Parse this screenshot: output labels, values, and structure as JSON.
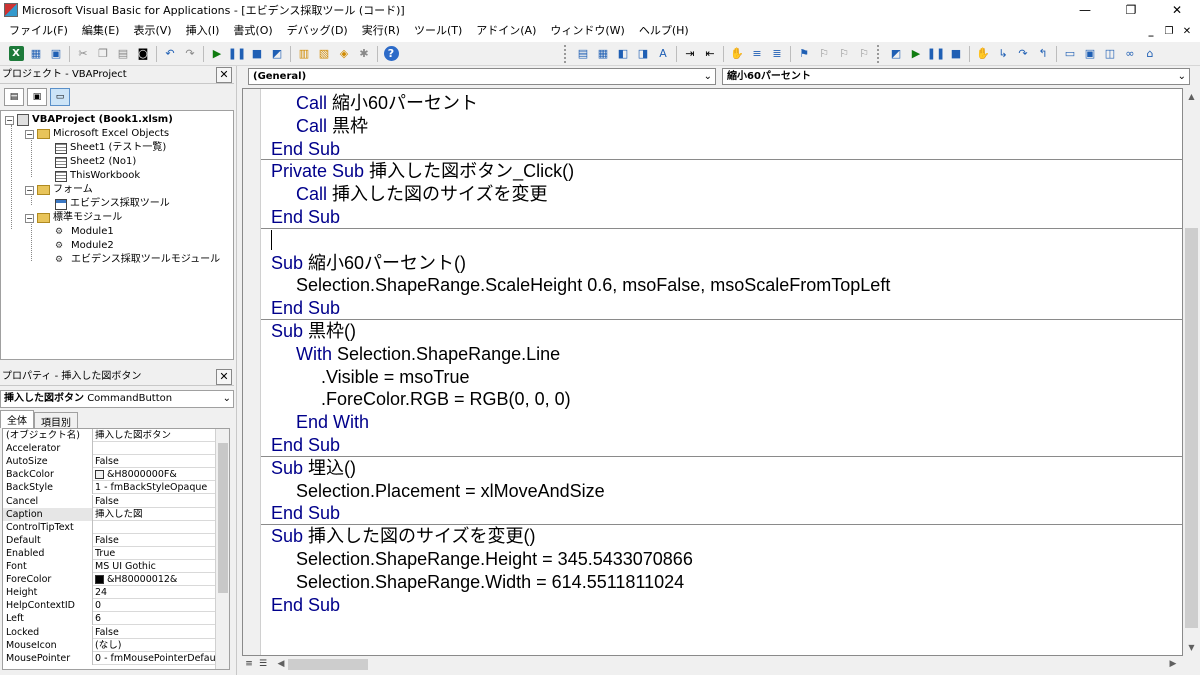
{
  "window": {
    "title": "Microsoft Visual Basic for Applications - [エビデンス採取ツール (コード)]",
    "minimize": "—",
    "restore": "❐",
    "close": "✕"
  },
  "menu": {
    "items": [
      "ファイル(F)",
      "編集(E)",
      "表示(V)",
      "挿入(I)",
      "書式(O)",
      "デバッグ(D)",
      "実行(R)",
      "ツール(T)",
      "アドイン(A)",
      "ウィンドウ(W)",
      "ヘルプ(H)"
    ],
    "mdi_min": "_",
    "mdi_restore": "❐",
    "mdi_close": "✕"
  },
  "toolbar": {
    "help_label": "?"
  },
  "project_pane": {
    "title": "プロジェクト - VBAProject",
    "close": "✕",
    "tree": {
      "project": "VBAProject (Book1.xlsm)",
      "excel_objects": "Microsoft Excel Objects",
      "sheet1": "Sheet1 (テスト一覧)",
      "sheet2": "Sheet2 (No1)",
      "thisworkbook": "ThisWorkbook",
      "forms": "フォーム",
      "form1": "エビデンス採取ツール",
      "modules": "標準モジュール",
      "module1": "Module1",
      "module2": "Module2",
      "module3": "エビデンス採取ツールモジュール"
    }
  },
  "properties_pane": {
    "title": "プロパティ - 挿入した図ボタン",
    "close": "✕",
    "object_combo_name": "挿入した図ボタン",
    "object_combo_type": "CommandButton",
    "tabs": [
      "全体",
      "項目別"
    ],
    "rows": [
      {
        "name": "(オブジェクト名)",
        "value": "挿入した図ボタン"
      },
      {
        "name": "Accelerator",
        "value": ""
      },
      {
        "name": "AutoSize",
        "value": "False"
      },
      {
        "name": "BackColor",
        "value": "&H8000000F&"
      },
      {
        "name": "BackStyle",
        "value": "1 - fmBackStyleOpaque"
      },
      {
        "name": "Cancel",
        "value": "False"
      },
      {
        "name": "Caption",
        "value": "挿入した図"
      },
      {
        "name": "ControlTipText",
        "value": ""
      },
      {
        "name": "Default",
        "value": "False"
      },
      {
        "name": "Enabled",
        "value": "True"
      },
      {
        "name": "Font",
        "value": "MS UI Gothic"
      },
      {
        "name": "ForeColor",
        "value": "&H80000012&"
      },
      {
        "name": "Height",
        "value": "24"
      },
      {
        "name": "HelpContextID",
        "value": "0"
      },
      {
        "name": "Left",
        "value": "6"
      },
      {
        "name": "Locked",
        "value": "False"
      },
      {
        "name": "MouseIcon",
        "value": "(なし)"
      },
      {
        "name": "MousePointer",
        "value": "0 - fmMousePointerDefau"
      }
    ],
    "colors": {
      "backcolor_swatch": "#f0f0f0",
      "forecolor_swatch": "#000000"
    }
  },
  "code_window": {
    "object_combo": "(General)",
    "procedure_combo": "縮小60パーセント",
    "lines": [
      {
        "indent": 1,
        "kw": "Call",
        "text": " 縮小60パーセント"
      },
      {
        "indent": 1,
        "kw": "Call",
        "text": " 黒枠"
      },
      {
        "indent": 0,
        "kw": "End Sub",
        "text": ""
      },
      {
        "indent": 0,
        "kw": "Private Sub",
        "text": " 挿入した図ボタン_Click()"
      },
      {
        "indent": 1,
        "kw": "Call",
        "text": " 挿入した図のサイズを変更"
      },
      {
        "indent": 0,
        "kw": "End Sub",
        "text": ""
      },
      {
        "indent": 0,
        "kw": "",
        "text": ""
      },
      {
        "indent": 0,
        "kw": "Sub",
        "text": " 縮小60パーセント()"
      },
      {
        "indent": 1,
        "kw": "",
        "text": "Selection.ShapeRange.ScaleHeight 0.6, msoFalse, msoScaleFromTopLeft"
      },
      {
        "indent": 0,
        "kw": "End Sub",
        "text": ""
      },
      {
        "indent": 0,
        "kw": "Sub",
        "text": " 黒枠()"
      },
      {
        "indent": 1,
        "kw": "With",
        "text": " Selection.ShapeRange.Line"
      },
      {
        "indent": 2,
        "kw": "",
        "text": ".Visible = msoTrue"
      },
      {
        "indent": 2,
        "kw": "",
        "text": ".ForeColor.RGB = RGB(0, 0, 0)"
      },
      {
        "indent": 1,
        "kw": "End With",
        "text": ""
      },
      {
        "indent": 0,
        "kw": "End Sub",
        "text": ""
      },
      {
        "indent": 0,
        "kw": "Sub",
        "text": " 埋込()"
      },
      {
        "indent": 1,
        "kw": "",
        "text": "Selection.Placement = xlMoveAndSize"
      },
      {
        "indent": 0,
        "kw": "End Sub",
        "text": ""
      },
      {
        "indent": 0,
        "kw": "Sub",
        "text": " 挿入した図のサイズを変更()"
      },
      {
        "indent": 1,
        "kw": "",
        "text": "Selection.ShapeRange.Height = 345.5433070866"
      },
      {
        "indent": 1,
        "kw": "",
        "text": "Selection.ShapeRange.Width = 614.5511811024"
      },
      {
        "indent": 0,
        "kw": "End Sub",
        "text": ""
      }
    ],
    "keyword_color": "#00008b"
  }
}
